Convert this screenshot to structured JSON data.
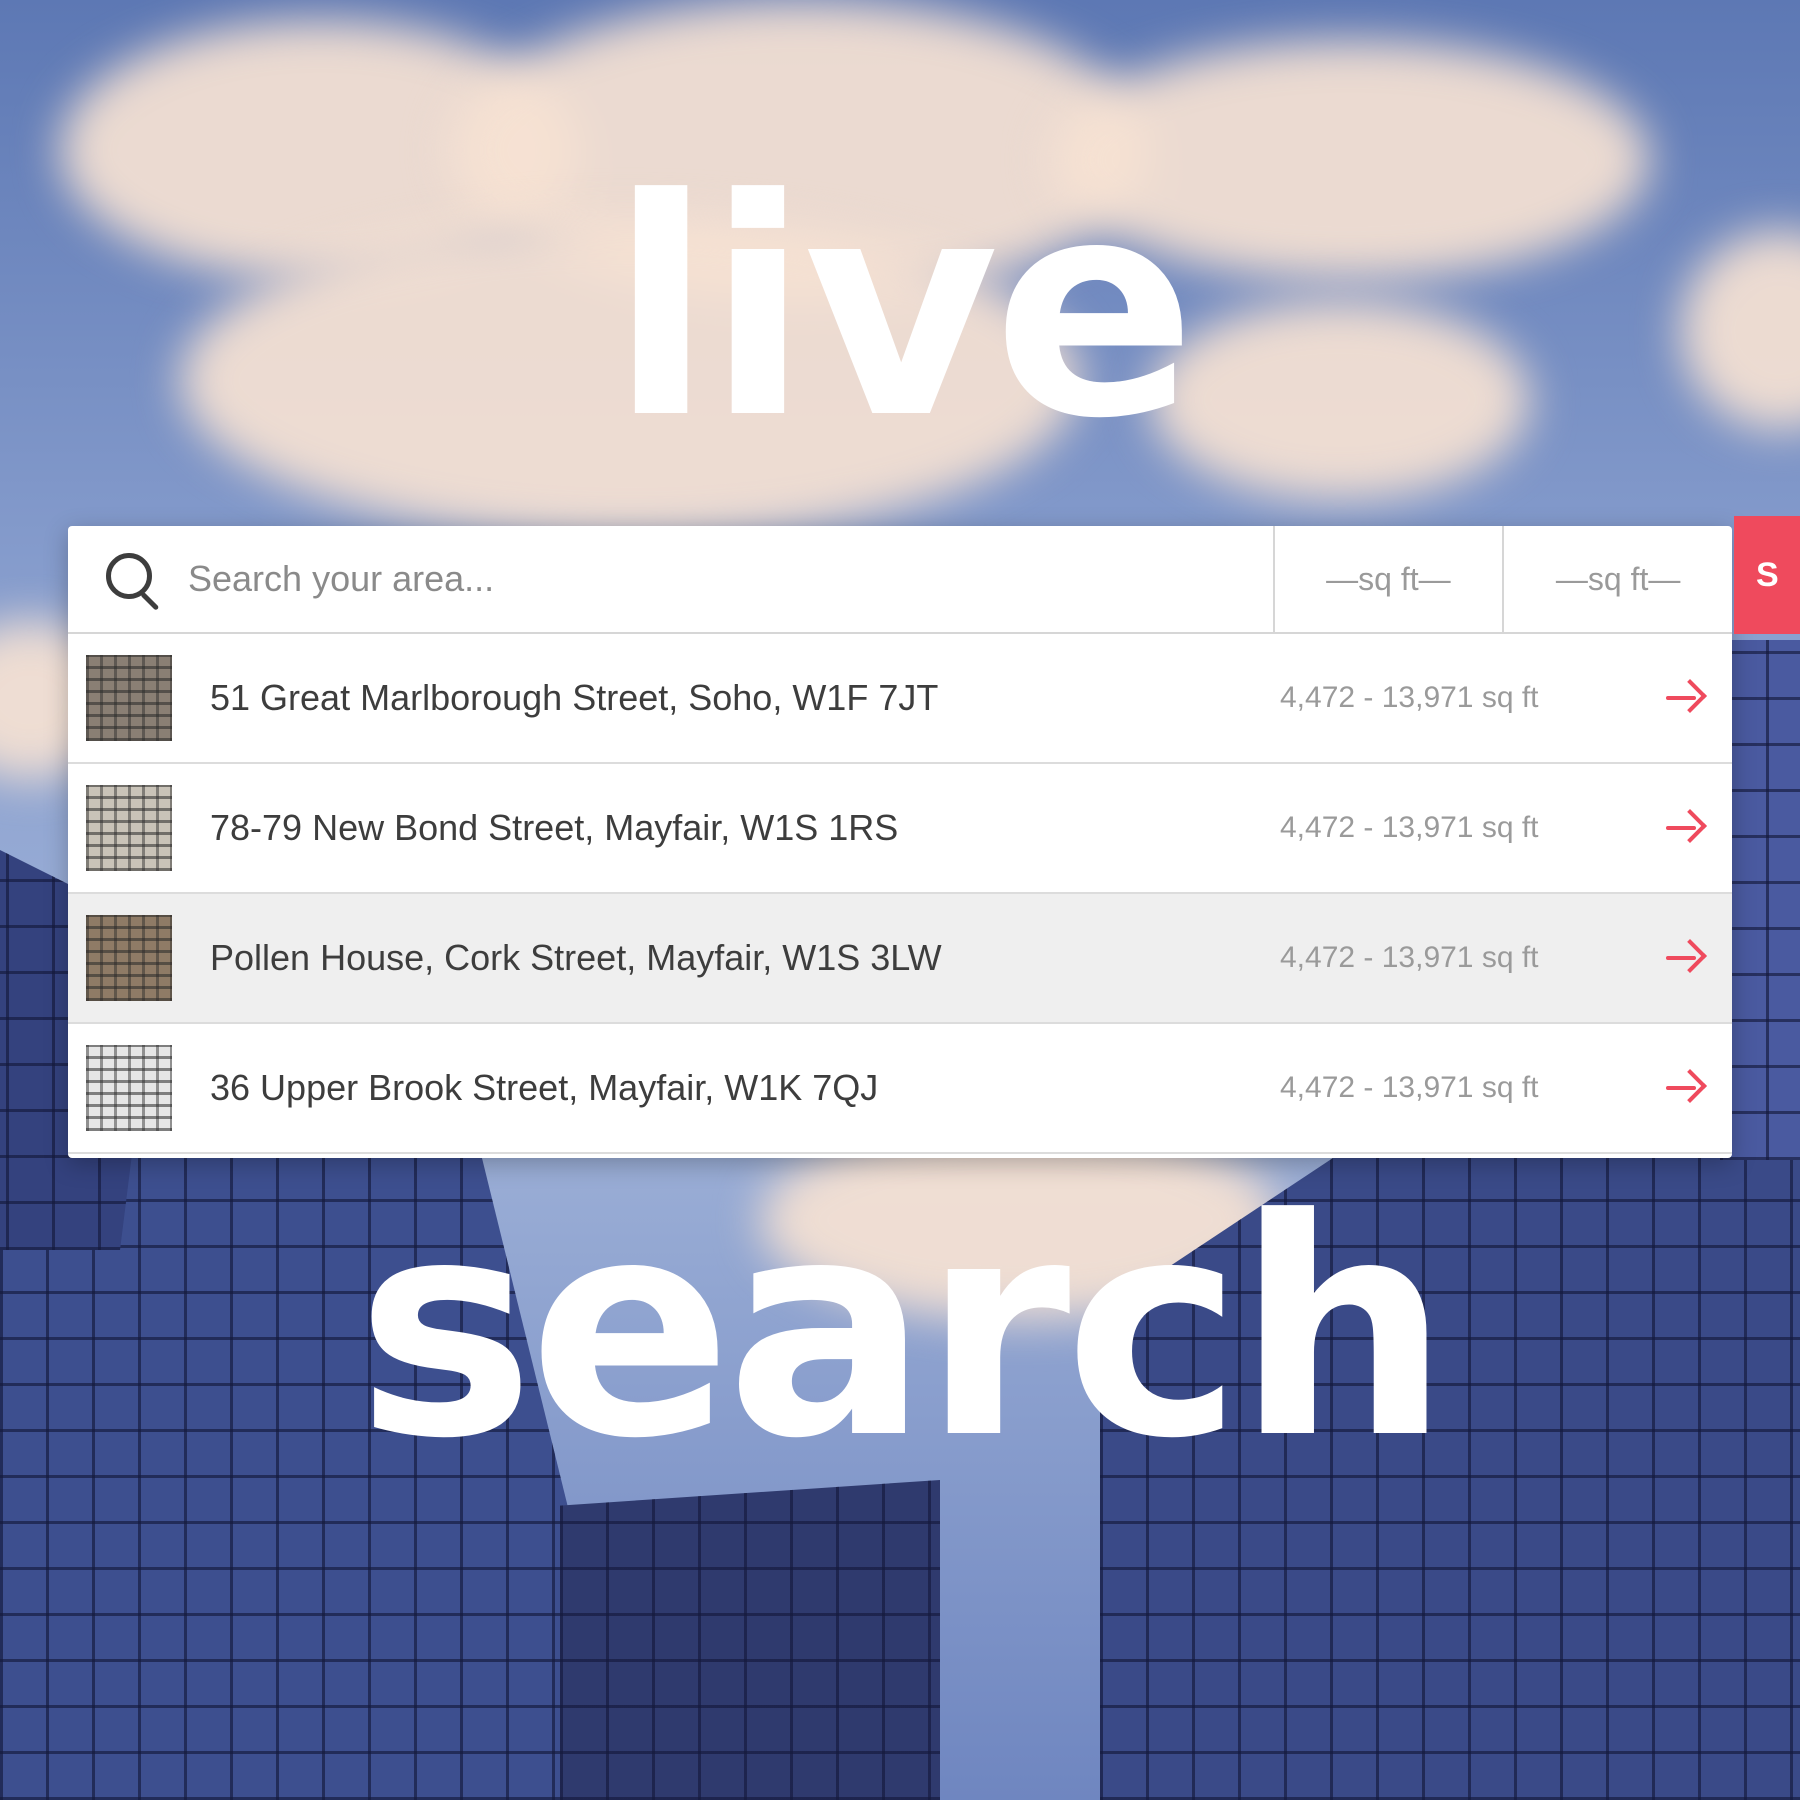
{
  "hero": {
    "top_word": "live",
    "bottom_word": "search"
  },
  "search": {
    "placeholder": "Search your area...",
    "min_sqft_label": "—sq ft—",
    "max_sqft_label": "—sq ft—",
    "button_label": "S"
  },
  "results": [
    {
      "address": "51 Great Marlborough Street, Soho, W1F 7JT",
      "range": "4,472 - 13,971 sq ft",
      "thumb_color": "#8a7f74"
    },
    {
      "address": "78-79 New Bond Street, Mayfair, W1S 1RS",
      "range": "4,472 - 13,971 sq ft",
      "thumb_color": "#c9c3b8"
    },
    {
      "address": "Pollen House, Cork Street, Mayfair, W1S 3LW",
      "range": "4,472 - 13,971 sq ft",
      "thumb_color": "#8f7b66"
    },
    {
      "address": "36 Upper Brook Street, Mayfair, W1K 7QJ",
      "range": "4,472 - 13,971 sq ft",
      "thumb_color": "#e6e6e6"
    }
  ],
  "colors": {
    "accent": "#ef4a5d",
    "highlight_row": "#efefef"
  }
}
